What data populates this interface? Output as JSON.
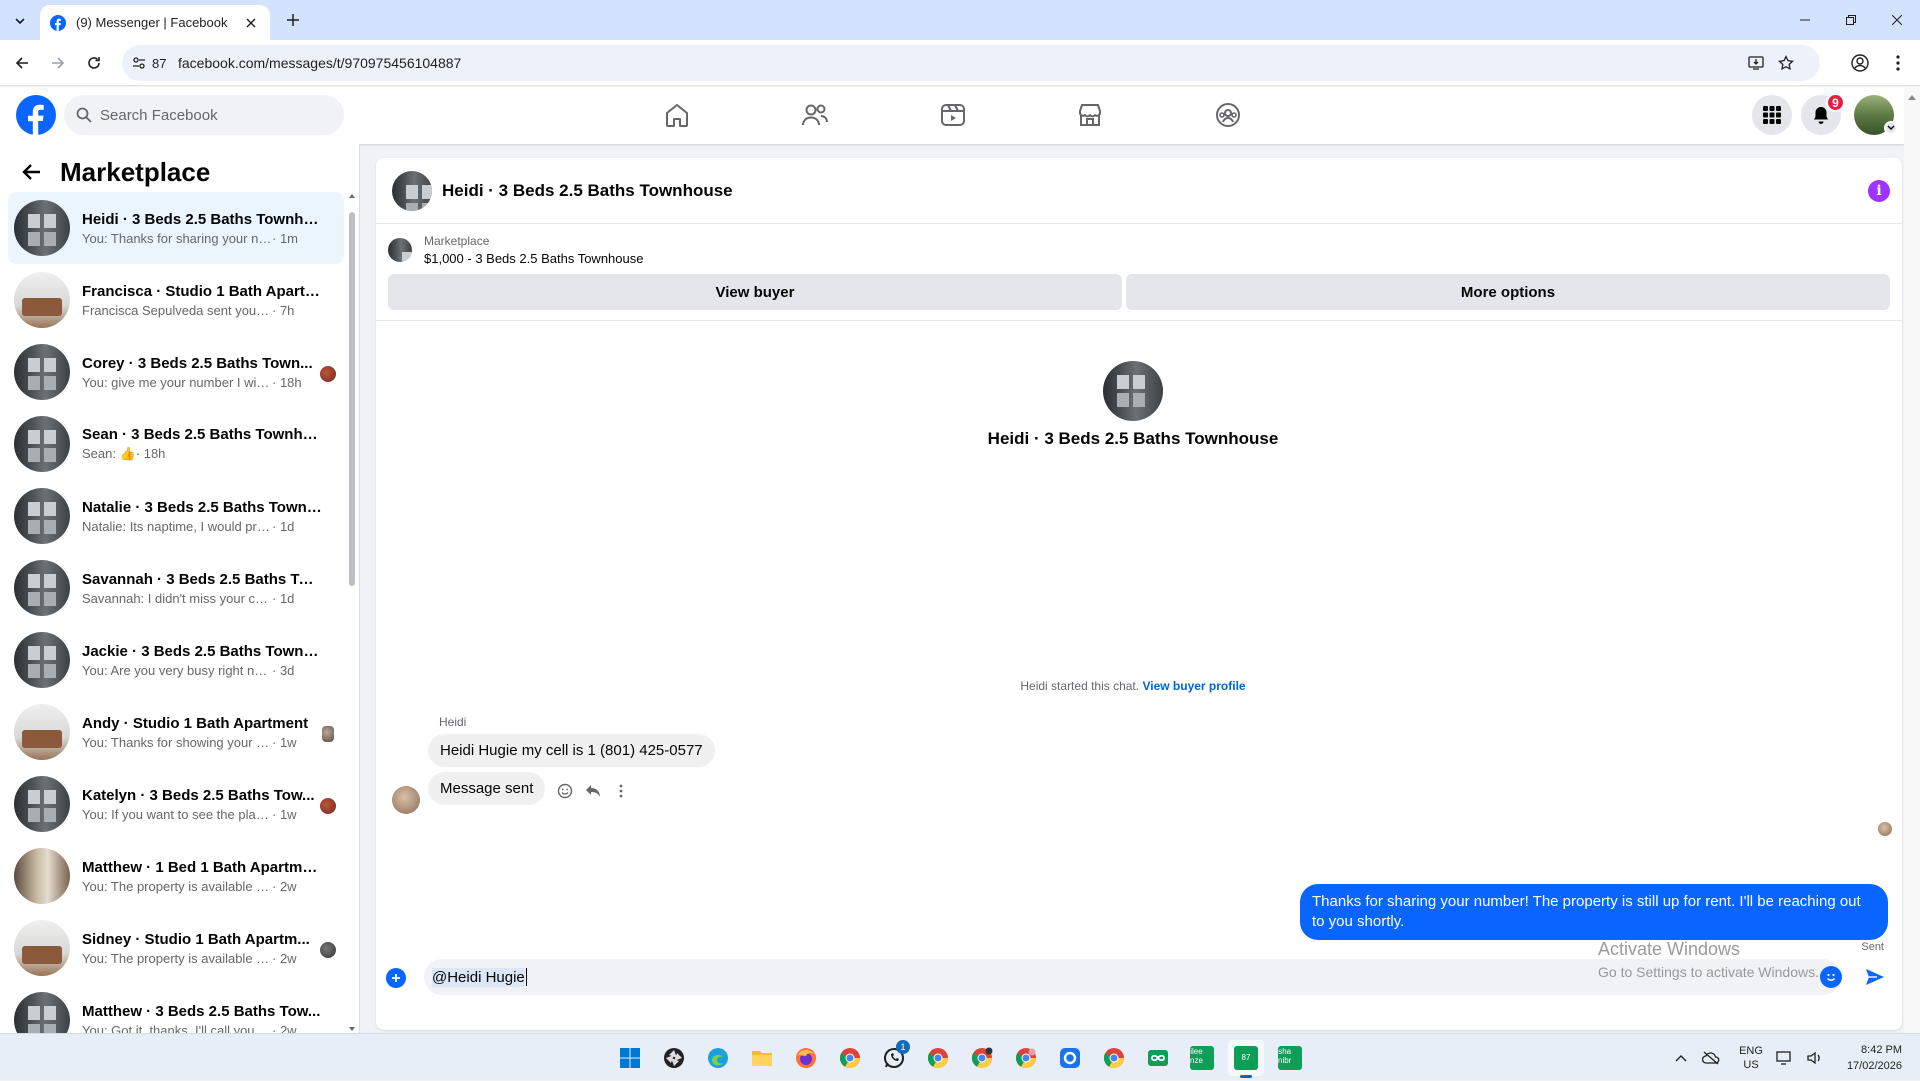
{
  "browser": {
    "tab_title": "(9) Messenger | Facebook",
    "url_host": "facebook.com",
    "url_path": "/messages/t/970975456104887",
    "site_info_count": "87"
  },
  "facebook": {
    "search_placeholder": "Search Facebook",
    "notification_count": "9"
  },
  "sidebar": {
    "title": "Marketplace",
    "conversations": [
      {
        "name": "Heidi · 3 Beds 2.5 Baths Townho...",
        "last": "You: Thanks for sharing your numb...",
        "time": "· 1m",
        "thumb": "townhouse",
        "active": true
      },
      {
        "name": "Francisca · Studio 1 Bath Apartm...",
        "last": "Francisca Sepulveda sent you a me...",
        "time": "· 7h",
        "thumb": "studio"
      },
      {
        "name": "Corey · 3 Beds 2.5 Baths Town...",
        "last": "You: give me your number I will...",
        "time": "· 18h",
        "thumb": "townhouse"
      },
      {
        "name": "Sean · 3 Beds 2.5 Baths Townho...",
        "last": "Sean: 👍",
        "time": "· 18h",
        "thumb": "townhouse"
      },
      {
        "name": "Natalie · 3 Beds 2.5 Baths Townh...",
        "last": "Natalie: Its naptime, I would prefer ...",
        "time": "· 1d",
        "thumb": "townhouse"
      },
      {
        "name": "Savannah · 3 Beds 2.5 Baths Tow...",
        "last": "Savannah: I didn't miss your call di...",
        "time": "· 1d",
        "thumb": "townhouse"
      },
      {
        "name": "Jackie · 3 Beds 2.5 Baths Townh...",
        "last": "You: Are you very busy right now?",
        "time": "· 3d",
        "thumb": "townhouse"
      },
      {
        "name": "Andy · Studio 1 Bath Apartment",
        "last": "You: Thanks for showing your in...",
        "time": "· 1w",
        "thumb": "studio"
      },
      {
        "name": "Katelyn · 3 Beds 2.5 Baths Tow...",
        "last": "You: If you want to see the place...",
        "time": "· 1w",
        "thumb": "townhouse"
      },
      {
        "name": "Matthew · 1 Bed 1 Bath Apartment",
        "last": "You: The property is available right ...",
        "time": "· 2w",
        "thumb": "bed"
      },
      {
        "name": "Sidney · Studio 1 Bath Apartm...",
        "last": "You: The property is available rig...",
        "time": "· 2w",
        "thumb": "studio"
      },
      {
        "name": "Matthew · 3 Beds 2.5 Baths Tow...",
        "last": "You: Got it, thanks, I'll call you soon.",
        "time": "· 2w",
        "thumb": "townhouse"
      }
    ]
  },
  "chat": {
    "header_title": "Heidi · 3 Beds 2.5 Baths Townhouse",
    "marketplace_label": "Marketplace",
    "listing": "$1,000 - 3 Beds 2.5 Baths Townhouse",
    "view_buyer": "View buyer",
    "more_options": "More options",
    "center_name": "Heidi · 3 Beds 2.5 Baths Townhouse",
    "started_text": "Heidi started this chat.",
    "view_buyer_profile": "View buyer profile",
    "sender_name": "Heidi",
    "incoming_1": "Heidi Hugie my cell is 1 (801) 425-0577",
    "incoming_2": "Message sent",
    "outgoing": "Thanks for sharing your number! The property is still up for rent. I'll be reaching out to you shortly.",
    "sent_status": "Sent",
    "composer_value": "@Heidi Hugie"
  },
  "watermark": {
    "line1": "Activate Windows",
    "line2": "Go to Settings to activate Windows."
  },
  "taskbar": {
    "whatsapp_badge": "1",
    "app_chip_1": "87",
    "app_chip_2a": "ilee",
    "app_chip_2b": "nze",
    "app_chip_3a": "sha",
    "app_chip_3b": "nibr",
    "lang_line1": "ENG",
    "lang_line2": "US",
    "time": "8:42 PM",
    "date": "17/02/2026"
  },
  "colors": {
    "facebook_blue": "#0866ff",
    "info_purple": "#a033ff",
    "badge_red": "#e41e3f"
  }
}
